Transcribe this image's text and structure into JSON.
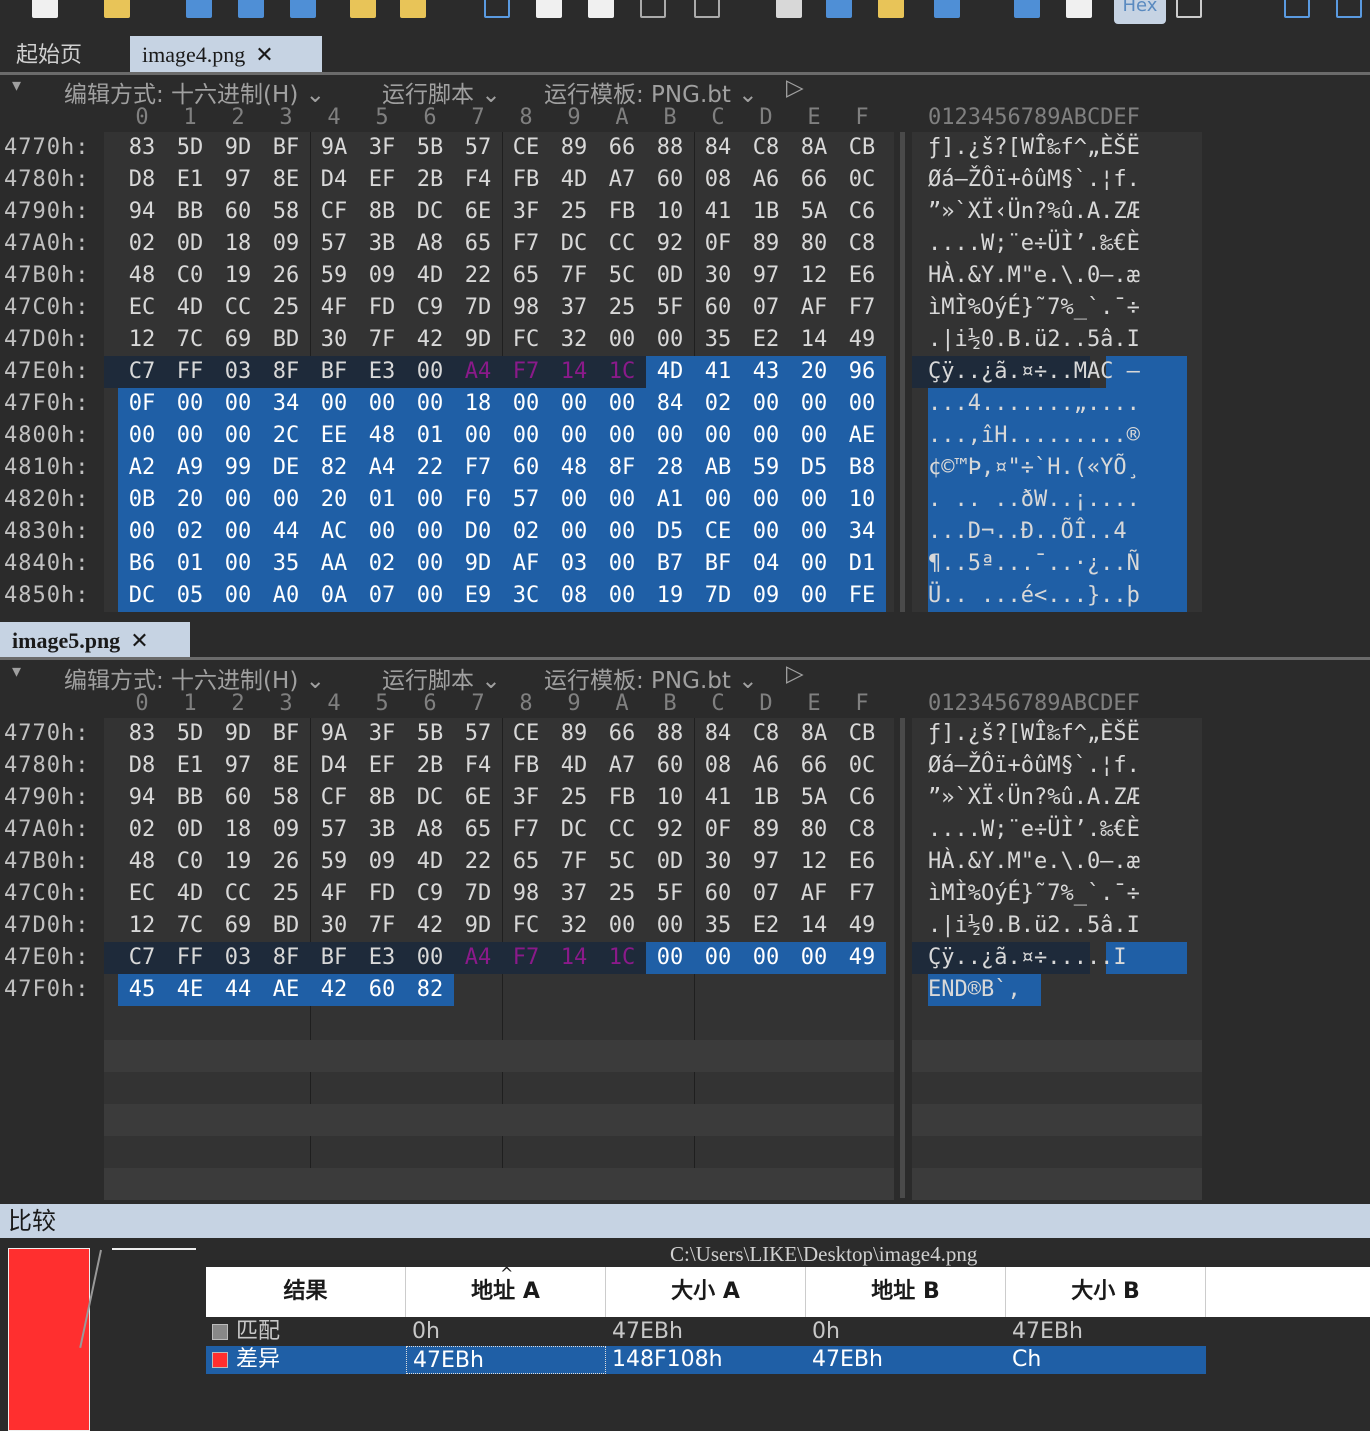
{
  "toolbar": {
    "hex_label": "Hex"
  },
  "top_tabs": [
    {
      "label": "起始页",
      "active": false
    },
    {
      "label": "image4.png",
      "active": true,
      "close": "✕"
    }
  ],
  "bottom_tab": {
    "label": "image5.png",
    "close": "✕"
  },
  "options": {
    "edit_mode": "编辑方式: 十六进制(H)",
    "run_script": "运行脚本",
    "run_template": "运行模板: PNG.bt",
    "chevron": "⌄",
    "play": "▷",
    "menu": "▾"
  },
  "column_header": {
    "hex": [
      "0",
      "1",
      "2",
      "3",
      "4",
      "5",
      "6",
      "7",
      "8",
      "9",
      "A",
      "B",
      "C",
      "D",
      "E",
      "F"
    ],
    "ascii": "0123456789ABCDEF"
  },
  "pane_a": {
    "rows": [
      {
        "addr": "4770h:",
        "bytes": [
          "83",
          "5D",
          "9D",
          "BF",
          "9A",
          "3F",
          "5B",
          "57",
          "CE",
          "89",
          "66",
          "88",
          "84",
          "C8",
          "8A",
          "CB"
        ],
        "ascii": "ƒ].¿š?[WÎ‰f^„ÈŠË"
      },
      {
        "addr": "4780h:",
        "bytes": [
          "D8",
          "E1",
          "97",
          "8E",
          "D4",
          "EF",
          "2B",
          "F4",
          "FB",
          "4D",
          "A7",
          "60",
          "08",
          "A6",
          "66",
          "0C"
        ],
        "ascii": "Øá—ŽÔï+ôûM§`.¦f."
      },
      {
        "addr": "4790h:",
        "bytes": [
          "94",
          "BB",
          "60",
          "58",
          "CF",
          "8B",
          "DC",
          "6E",
          "3F",
          "25",
          "FB",
          "10",
          "41",
          "1B",
          "5A",
          "C6"
        ],
        "ascii": "”»`XÏ‹Ün?%û.A.ZÆ"
      },
      {
        "addr": "47A0h:",
        "bytes": [
          "02",
          "0D",
          "18",
          "09",
          "57",
          "3B",
          "A8",
          "65",
          "F7",
          "DC",
          "CC",
          "92",
          "0F",
          "89",
          "80",
          "C8"
        ],
        "ascii": "....W;¨e÷ÜÌ’.‰€È"
      },
      {
        "addr": "47B0h:",
        "bytes": [
          "48",
          "C0",
          "19",
          "26",
          "59",
          "09",
          "4D",
          "22",
          "65",
          "7F",
          "5C",
          "0D",
          "30",
          "97",
          "12",
          "E6"
        ],
        "ascii": "HÀ.&Y.M\"e.\\.0—.æ"
      },
      {
        "addr": "47C0h:",
        "bytes": [
          "EC",
          "4D",
          "CC",
          "25",
          "4F",
          "FD",
          "C9",
          "7D",
          "98",
          "37",
          "25",
          "5F",
          "60",
          "07",
          "AF",
          "F7"
        ],
        "ascii": "ìMÌ%OýÉ}˜7%_`.¯÷"
      },
      {
        "addr": "47D0h:",
        "bytes": [
          "12",
          "7C",
          "69",
          "BD",
          "30",
          "7F",
          "42",
          "9D",
          "FC",
          "32",
          "00",
          "00",
          "35",
          "E2",
          "14",
          "49"
        ],
        "ascii": ".|i½0.B.ü2..5â.I"
      },
      {
        "addr": "47E0h:",
        "bytes": [
          "C7",
          "FF",
          "03",
          "8F",
          "BF",
          "E3",
          "00",
          "A4",
          "F7",
          "14",
          "1C",
          "4D",
          "41",
          "43",
          "20",
          "96"
        ],
        "ascii": "Çÿ..¿ã.¤÷..MAC –"
      },
      {
        "addr": "47F0h:",
        "bytes": [
          "0F",
          "00",
          "00",
          "34",
          "00",
          "00",
          "00",
          "18",
          "00",
          "00",
          "00",
          "84",
          "02",
          "00",
          "00",
          "00"
        ],
        "ascii": "...4.......„...."
      },
      {
        "addr": "4800h:",
        "bytes": [
          "00",
          "00",
          "00",
          "2C",
          "EE",
          "48",
          "01",
          "00",
          "00",
          "00",
          "00",
          "00",
          "00",
          "00",
          "00",
          "AE"
        ],
        "ascii": "...,îH.........®"
      },
      {
        "addr": "4810h:",
        "bytes": [
          "A2",
          "A9",
          "99",
          "DE",
          "82",
          "A4",
          "22",
          "F7",
          "60",
          "48",
          "8F",
          "28",
          "AB",
          "59",
          "D5",
          "B8"
        ],
        "ascii": "¢©™Þ‚¤\"÷`H.(«YÕ¸"
      },
      {
        "addr": "4820h:",
        "bytes": [
          "0B",
          "20",
          "00",
          "00",
          "20",
          "01",
          "00",
          "F0",
          "57",
          "00",
          "00",
          "A1",
          "00",
          "00",
          "00",
          "10"
        ],
        "ascii": ". .. ..ðW..¡...."
      },
      {
        "addr": "4830h:",
        "bytes": [
          "00",
          "02",
          "00",
          "44",
          "AC",
          "00",
          "00",
          "D0",
          "02",
          "00",
          "00",
          "D5",
          "CE",
          "00",
          "00",
          "34"
        ],
        "ascii": "...D¬..Ð..ÕÎ..4"
      },
      {
        "addr": "4840h:",
        "bytes": [
          "B6",
          "01",
          "00",
          "35",
          "AA",
          "02",
          "00",
          "9D",
          "AF",
          "03",
          "00",
          "B7",
          "BF",
          "04",
          "00",
          "D1"
        ],
        "ascii": "¶..5ª...¯..·¿..Ñ"
      },
      {
        "addr": "4850h:",
        "bytes": [
          "DC",
          "05",
          "00",
          "A0",
          "0A",
          "07",
          "00",
          "E9",
          "3C",
          "08",
          "00",
          "19",
          "7D",
          "09",
          "00",
          "FE"
        ],
        "ascii": "Ü.. ...é<...}..þ"
      }
    ]
  },
  "pane_b": {
    "rows": [
      {
        "addr": "4770h:",
        "bytes": [
          "83",
          "5D",
          "9D",
          "BF",
          "9A",
          "3F",
          "5B",
          "57",
          "CE",
          "89",
          "66",
          "88",
          "84",
          "C8",
          "8A",
          "CB"
        ],
        "ascii": "ƒ].¿š?[WÎ‰f^„ÈŠË"
      },
      {
        "addr": "4780h:",
        "bytes": [
          "D8",
          "E1",
          "97",
          "8E",
          "D4",
          "EF",
          "2B",
          "F4",
          "FB",
          "4D",
          "A7",
          "60",
          "08",
          "A6",
          "66",
          "0C"
        ],
        "ascii": "Øá—ŽÔï+ôûM§`.¦f."
      },
      {
        "addr": "4790h:",
        "bytes": [
          "94",
          "BB",
          "60",
          "58",
          "CF",
          "8B",
          "DC",
          "6E",
          "3F",
          "25",
          "FB",
          "10",
          "41",
          "1B",
          "5A",
          "C6"
        ],
        "ascii": "”»`XÏ‹Ün?%û.A.ZÆ"
      },
      {
        "addr": "47A0h:",
        "bytes": [
          "02",
          "0D",
          "18",
          "09",
          "57",
          "3B",
          "A8",
          "65",
          "F7",
          "DC",
          "CC",
          "92",
          "0F",
          "89",
          "80",
          "C8"
        ],
        "ascii": "....W;¨e÷ÜÌ’.‰€È"
      },
      {
        "addr": "47B0h:",
        "bytes": [
          "48",
          "C0",
          "19",
          "26",
          "59",
          "09",
          "4D",
          "22",
          "65",
          "7F",
          "5C",
          "0D",
          "30",
          "97",
          "12",
          "E6"
        ],
        "ascii": "HÀ.&Y.M\"e.\\.0—.æ"
      },
      {
        "addr": "47C0h:",
        "bytes": [
          "EC",
          "4D",
          "CC",
          "25",
          "4F",
          "FD",
          "C9",
          "7D",
          "98",
          "37",
          "25",
          "5F",
          "60",
          "07",
          "AF",
          "F7"
        ],
        "ascii": "ìMÌ%OýÉ}˜7%_`.¯÷"
      },
      {
        "addr": "47D0h:",
        "bytes": [
          "12",
          "7C",
          "69",
          "BD",
          "30",
          "7F",
          "42",
          "9D",
          "FC",
          "32",
          "00",
          "00",
          "35",
          "E2",
          "14",
          "49"
        ],
        "ascii": ".|i½0.B.ü2..5â.I"
      },
      {
        "addr": "47E0h:",
        "bytes": [
          "C7",
          "FF",
          "03",
          "8F",
          "BF",
          "E3",
          "00",
          "A4",
          "F7",
          "14",
          "1C",
          "00",
          "00",
          "00",
          "00",
          "49"
        ],
        "ascii": "Çÿ..¿ã.¤÷.....I"
      },
      {
        "addr": "47F0h:",
        "bytes": [
          "45",
          "4E",
          "44",
          "AE",
          "42",
          "60",
          "82"
        ],
        "ascii": "END®B`‚"
      }
    ]
  },
  "compare": {
    "title": "比较",
    "path": "C:\\Users\\LIKE\\Desktop\\image4.png",
    "columns": [
      "结果",
      "地址 A",
      "大小 A",
      "地址 B",
      "大小 B"
    ],
    "sort_indicator": "^",
    "rows": [
      {
        "result": "匹配",
        "addr_a": "0h",
        "size_a": "47EBh",
        "addr_b": "0h",
        "size_b": "47EBh",
        "color": "#888888",
        "selected": false
      },
      {
        "result": "差异",
        "addr_a": "47EBh",
        "size_a": "148F108h",
        "addr_b": "47EBh",
        "size_b": "Ch",
        "color": "#ff2f2f",
        "selected": true
      }
    ]
  }
}
